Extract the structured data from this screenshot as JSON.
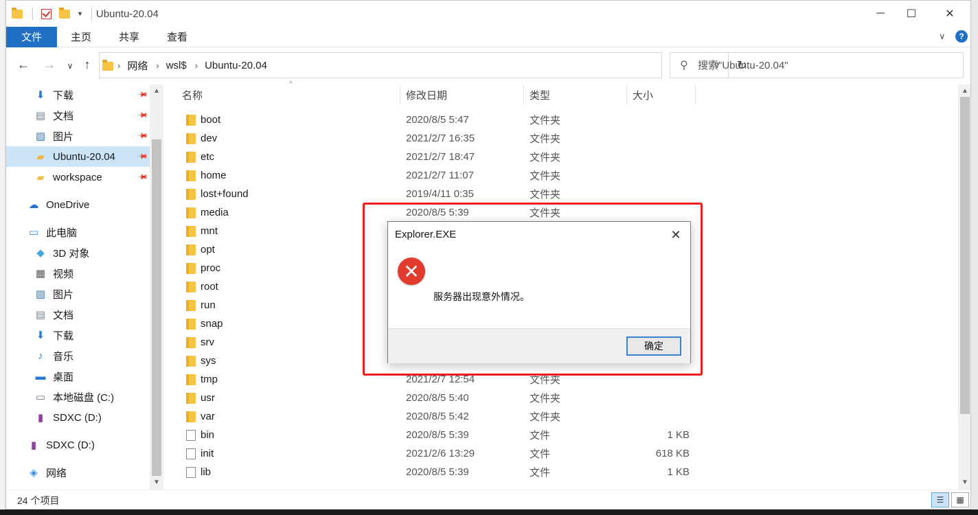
{
  "window": {
    "title": "Ubuntu-20.04",
    "minimize_icon": "─",
    "maximize_icon": "☐",
    "close_icon": "✕"
  },
  "ribbon": {
    "tabs": [
      "文件",
      "主页",
      "共享",
      "查看"
    ]
  },
  "address": {
    "crumbs": [
      "网络",
      "wsl$",
      "Ubuntu-20.04"
    ]
  },
  "search": {
    "placeholder": "搜索\"Ubuntu-20.04\""
  },
  "nav": {
    "items": [
      {
        "label": "下载",
        "icon": "download-arrow-icon",
        "pinned": true
      },
      {
        "label": "文档",
        "icon": "document-icon",
        "pinned": true
      },
      {
        "label": "图片",
        "icon": "picture-icon",
        "pinned": true
      },
      {
        "label": "Ubuntu-20.04",
        "icon": "linux-folder-icon",
        "pinned": true,
        "selected": true
      },
      {
        "label": "workspace",
        "icon": "folder-icon",
        "pinned": true
      },
      {
        "label": "OneDrive",
        "icon": "cloud-icon"
      },
      {
        "label": "此电脑",
        "icon": "computer-icon"
      },
      {
        "label": "3D 对象",
        "icon": "cube-icon"
      },
      {
        "label": "视频",
        "icon": "video-icon"
      },
      {
        "label": "图片",
        "icon": "picture-icon"
      },
      {
        "label": "文档",
        "icon": "document-icon"
      },
      {
        "label": "下载",
        "icon": "download-arrow-icon"
      },
      {
        "label": "音乐",
        "icon": "music-note-icon"
      },
      {
        "label": "桌面",
        "icon": "desktop-icon"
      },
      {
        "label": "本地磁盘 (C:)",
        "icon": "drive-icon"
      },
      {
        "label": "SDXC (D:)",
        "icon": "sd-card-icon"
      },
      {
        "label": "SDXC (D:)",
        "icon": "sd-card-icon"
      },
      {
        "label": "网络",
        "icon": "network-icon"
      }
    ]
  },
  "columns": {
    "name": "名称",
    "modified": "修改日期",
    "type": "类型",
    "size": "大小"
  },
  "files": [
    {
      "name": "boot",
      "date": "2020/8/5 5:47",
      "type": "文件夹",
      "size": "",
      "kind": "folder"
    },
    {
      "name": "dev",
      "date": "2021/2/7 16:35",
      "type": "文件夹",
      "size": "",
      "kind": "folder"
    },
    {
      "name": "etc",
      "date": "2021/2/7 18:47",
      "type": "文件夹",
      "size": "",
      "kind": "folder"
    },
    {
      "name": "home",
      "date": "2021/2/7 11:07",
      "type": "文件夹",
      "size": "",
      "kind": "folder"
    },
    {
      "name": "lost+found",
      "date": "2019/4/11 0:35",
      "type": "文件夹",
      "size": "",
      "kind": "folder"
    },
    {
      "name": "media",
      "date": "2020/8/5 5:39",
      "type": "文件夹",
      "size": "",
      "kind": "folder"
    },
    {
      "name": "mnt",
      "date": "",
      "type": "",
      "size": "",
      "kind": "folder"
    },
    {
      "name": "opt",
      "date": "",
      "type": "",
      "size": "",
      "kind": "folder"
    },
    {
      "name": "proc",
      "date": "",
      "type": "",
      "size": "",
      "kind": "folder"
    },
    {
      "name": "root",
      "date": "",
      "type": "",
      "size": "",
      "kind": "folder"
    },
    {
      "name": "run",
      "date": "",
      "type": "",
      "size": "",
      "kind": "folder"
    },
    {
      "name": "snap",
      "date": "",
      "type": "",
      "size": "",
      "kind": "folder"
    },
    {
      "name": "srv",
      "date": "",
      "type": "",
      "size": "",
      "kind": "folder"
    },
    {
      "name": "sys",
      "date": "",
      "type": "",
      "size": "",
      "kind": "folder"
    },
    {
      "name": "tmp",
      "date": "2021/2/7 12:54",
      "type": "文件夹",
      "size": "",
      "kind": "folder"
    },
    {
      "name": "usr",
      "date": "2020/8/5 5:40",
      "type": "文件夹",
      "size": "",
      "kind": "folder"
    },
    {
      "name": "var",
      "date": "2020/8/5 5:42",
      "type": "文件夹",
      "size": "",
      "kind": "folder"
    },
    {
      "name": "bin",
      "date": "2020/8/5 5:39",
      "type": "文件",
      "size": "1 KB",
      "kind": "file"
    },
    {
      "name": "init",
      "date": "2021/2/6 13:29",
      "type": "文件",
      "size": "618 KB",
      "kind": "file"
    },
    {
      "name": "lib",
      "date": "2020/8/5 5:39",
      "type": "文件",
      "size": "1 KB",
      "kind": "file"
    }
  ],
  "status": {
    "count": "24 个项目"
  },
  "dialog": {
    "title": "Explorer.EXE",
    "message": "服务器出现意外情况。",
    "ok": "确定",
    "close_icon": "✕",
    "error_glyph": "✕"
  },
  "colors": {
    "accent": "#1f6fc5",
    "highlight": "#ee1c1c",
    "error": "#e23b2e",
    "selected": "#cce4f7"
  }
}
